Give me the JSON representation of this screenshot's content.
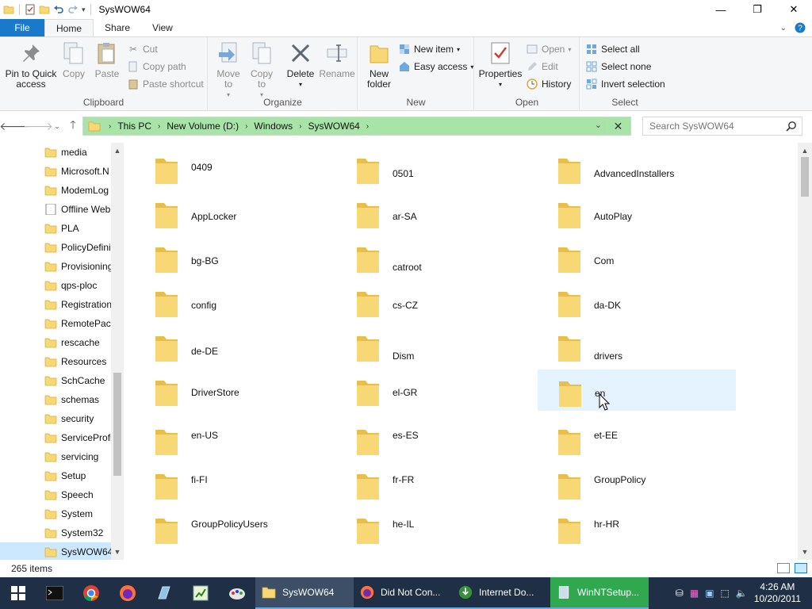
{
  "window": {
    "title": "SysWOW64",
    "minimize": "—",
    "maximize": "❐",
    "close": "✕"
  },
  "tabs": {
    "file": "File",
    "home": "Home",
    "share": "Share",
    "view": "View"
  },
  "ribbon": {
    "clipboard": {
      "label": "Clipboard",
      "pin": "Pin to Quick access",
      "copy": "Copy",
      "paste": "Paste",
      "cut": "Cut",
      "copy_path": "Copy path",
      "paste_shortcut": "Paste shortcut"
    },
    "organize": {
      "label": "Organize",
      "move_to": "Move to",
      "copy_to": "Copy to",
      "delete": "Delete",
      "rename": "Rename"
    },
    "new": {
      "label": "New",
      "new_folder": "New folder",
      "new_item": "New item",
      "easy_access": "Easy access"
    },
    "open": {
      "label": "Open",
      "properties": "Properties",
      "open": "Open",
      "edit": "Edit",
      "history": "History"
    },
    "select": {
      "label": "Select",
      "select_all": "Select all",
      "select_none": "Select none",
      "invert": "Invert selection"
    }
  },
  "address": {
    "crumbs": [
      "This PC",
      "New Volume (D:)",
      "Windows",
      "SysWOW64"
    ]
  },
  "search": {
    "placeholder": "Search SysWOW64"
  },
  "navpane": {
    "items": [
      "media",
      "Microsoft.N",
      "ModemLog",
      "Offline Web",
      "PLA",
      "PolicyDefini",
      "Provisioning",
      "qps-ploc",
      "Registration",
      "RemotePacl",
      "rescache",
      "Resources",
      "SchCache",
      "schemas",
      "security",
      "ServiceProfi",
      "servicing",
      "Setup",
      "Speech",
      "System",
      "System32",
      "SysWOW64"
    ]
  },
  "folders": [
    "0409",
    "0501",
    "AdvancedInstallers",
    "AppLocker",
    "ar-SA",
    "AutoPlay",
    "bg-BG",
    "catroot",
    "Com",
    "config",
    "cs-CZ",
    "da-DK",
    "de-DE",
    "Dism",
    "drivers",
    "DriverStore",
    "el-GR",
    "en",
    "en-US",
    "es-ES",
    "et-EE",
    "fi-FI",
    "fr-FR",
    "GroupPolicy",
    "GroupPolicyUsers",
    "he-IL",
    "hr-HR"
  ],
  "status": {
    "count": "265 items"
  },
  "taskbar": {
    "apps": [
      "SysWOW64",
      "Did Not Con...",
      "Internet Do...",
      "WinNTSetup..."
    ],
    "time": "4:26 AM",
    "date": "10/20/2011"
  },
  "colors": {
    "accent": "#1979ca",
    "address_bg": "#a8e3a8",
    "folder": "#f8d775",
    "taskbar": "#1f2f45",
    "hover": "#e5f3ff"
  }
}
